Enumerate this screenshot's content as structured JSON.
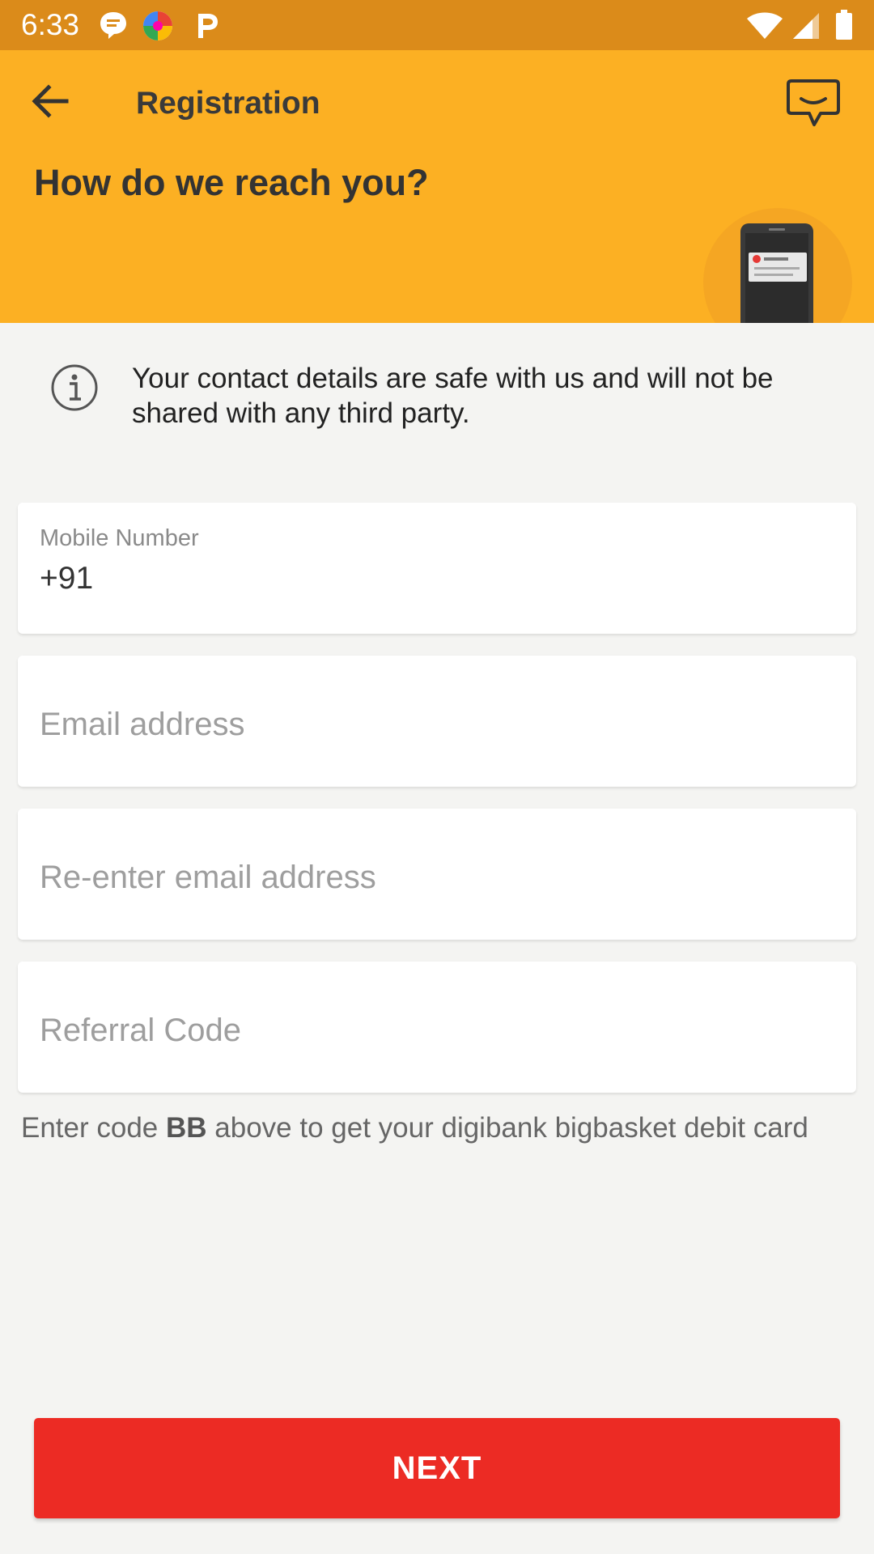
{
  "status_bar": {
    "time": "6:33",
    "notifications": [
      "messages-icon",
      "photos-icon",
      "paytm-icon"
    ],
    "indicators": [
      "wifi-icon",
      "signal-icon",
      "battery-icon"
    ]
  },
  "header": {
    "title": "Registration",
    "headline": "How do we reach you?",
    "background_color": "#fcb023"
  },
  "info": {
    "text": "Your contact details are safe with us and will not be shared with any third party."
  },
  "form": {
    "mobile": {
      "label": "Mobile Number",
      "value": "+91"
    },
    "email": {
      "placeholder": "Email address"
    },
    "email_confirm": {
      "placeholder": "Re-enter email address"
    },
    "referral": {
      "placeholder": "Referral Code"
    }
  },
  "referral_hint": {
    "prefix": "Enter code ",
    "code": "BB",
    "suffix": " above to get your digibank bigbasket debit card"
  },
  "next_button": {
    "label": "NEXT",
    "color": "#ec2b24"
  }
}
